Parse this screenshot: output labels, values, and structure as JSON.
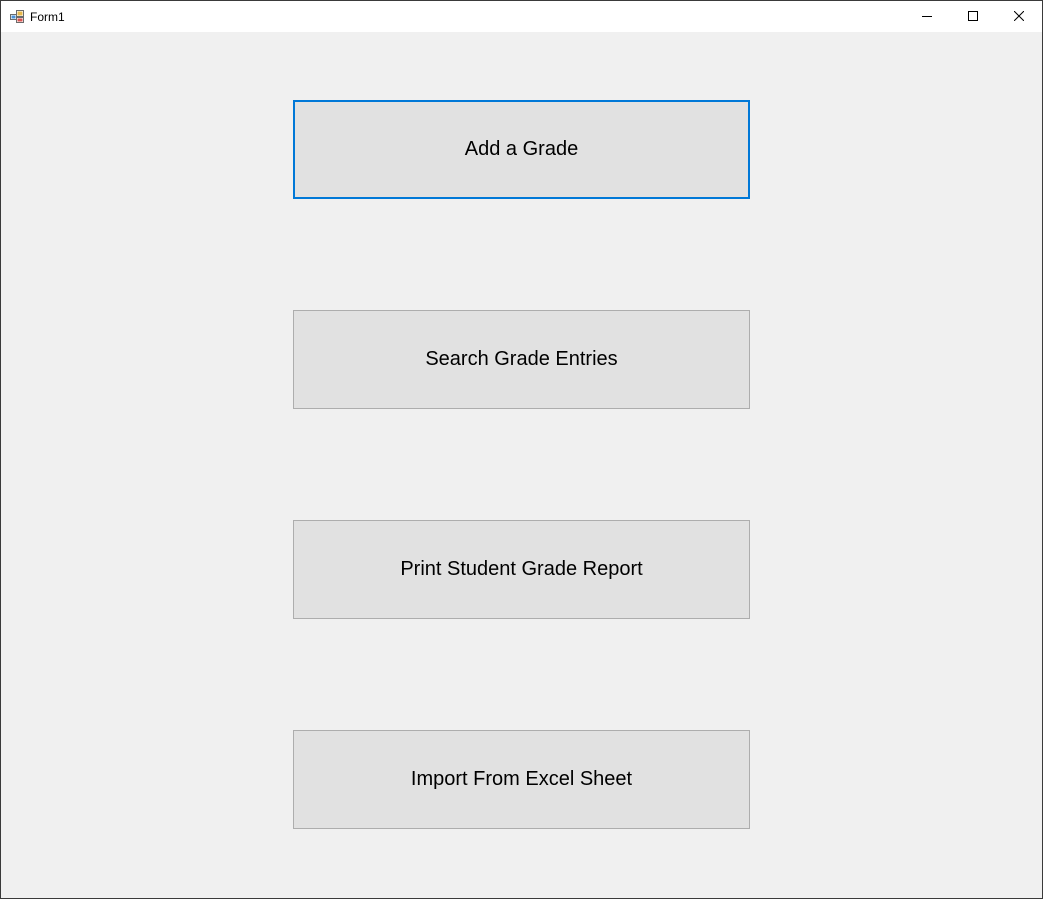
{
  "window": {
    "title": "Form1",
    "icon": "winforms-app-icon",
    "controls": {
      "minimize_icon": "minimize-icon",
      "maximize_icon": "maximize-icon",
      "close_icon": "close-icon"
    }
  },
  "buttons": [
    {
      "label": "Add a Grade",
      "focused": true
    },
    {
      "label": "Search Grade Entries",
      "focused": false
    },
    {
      "label": "Print Student Grade Report",
      "focused": false
    },
    {
      "label": "Import From Excel Sheet",
      "focused": false
    }
  ],
  "colors": {
    "window_background": "#f0f0f0",
    "button_face": "#e1e1e1",
    "button_border": "#adadad",
    "focus_border": "#0078d7"
  }
}
